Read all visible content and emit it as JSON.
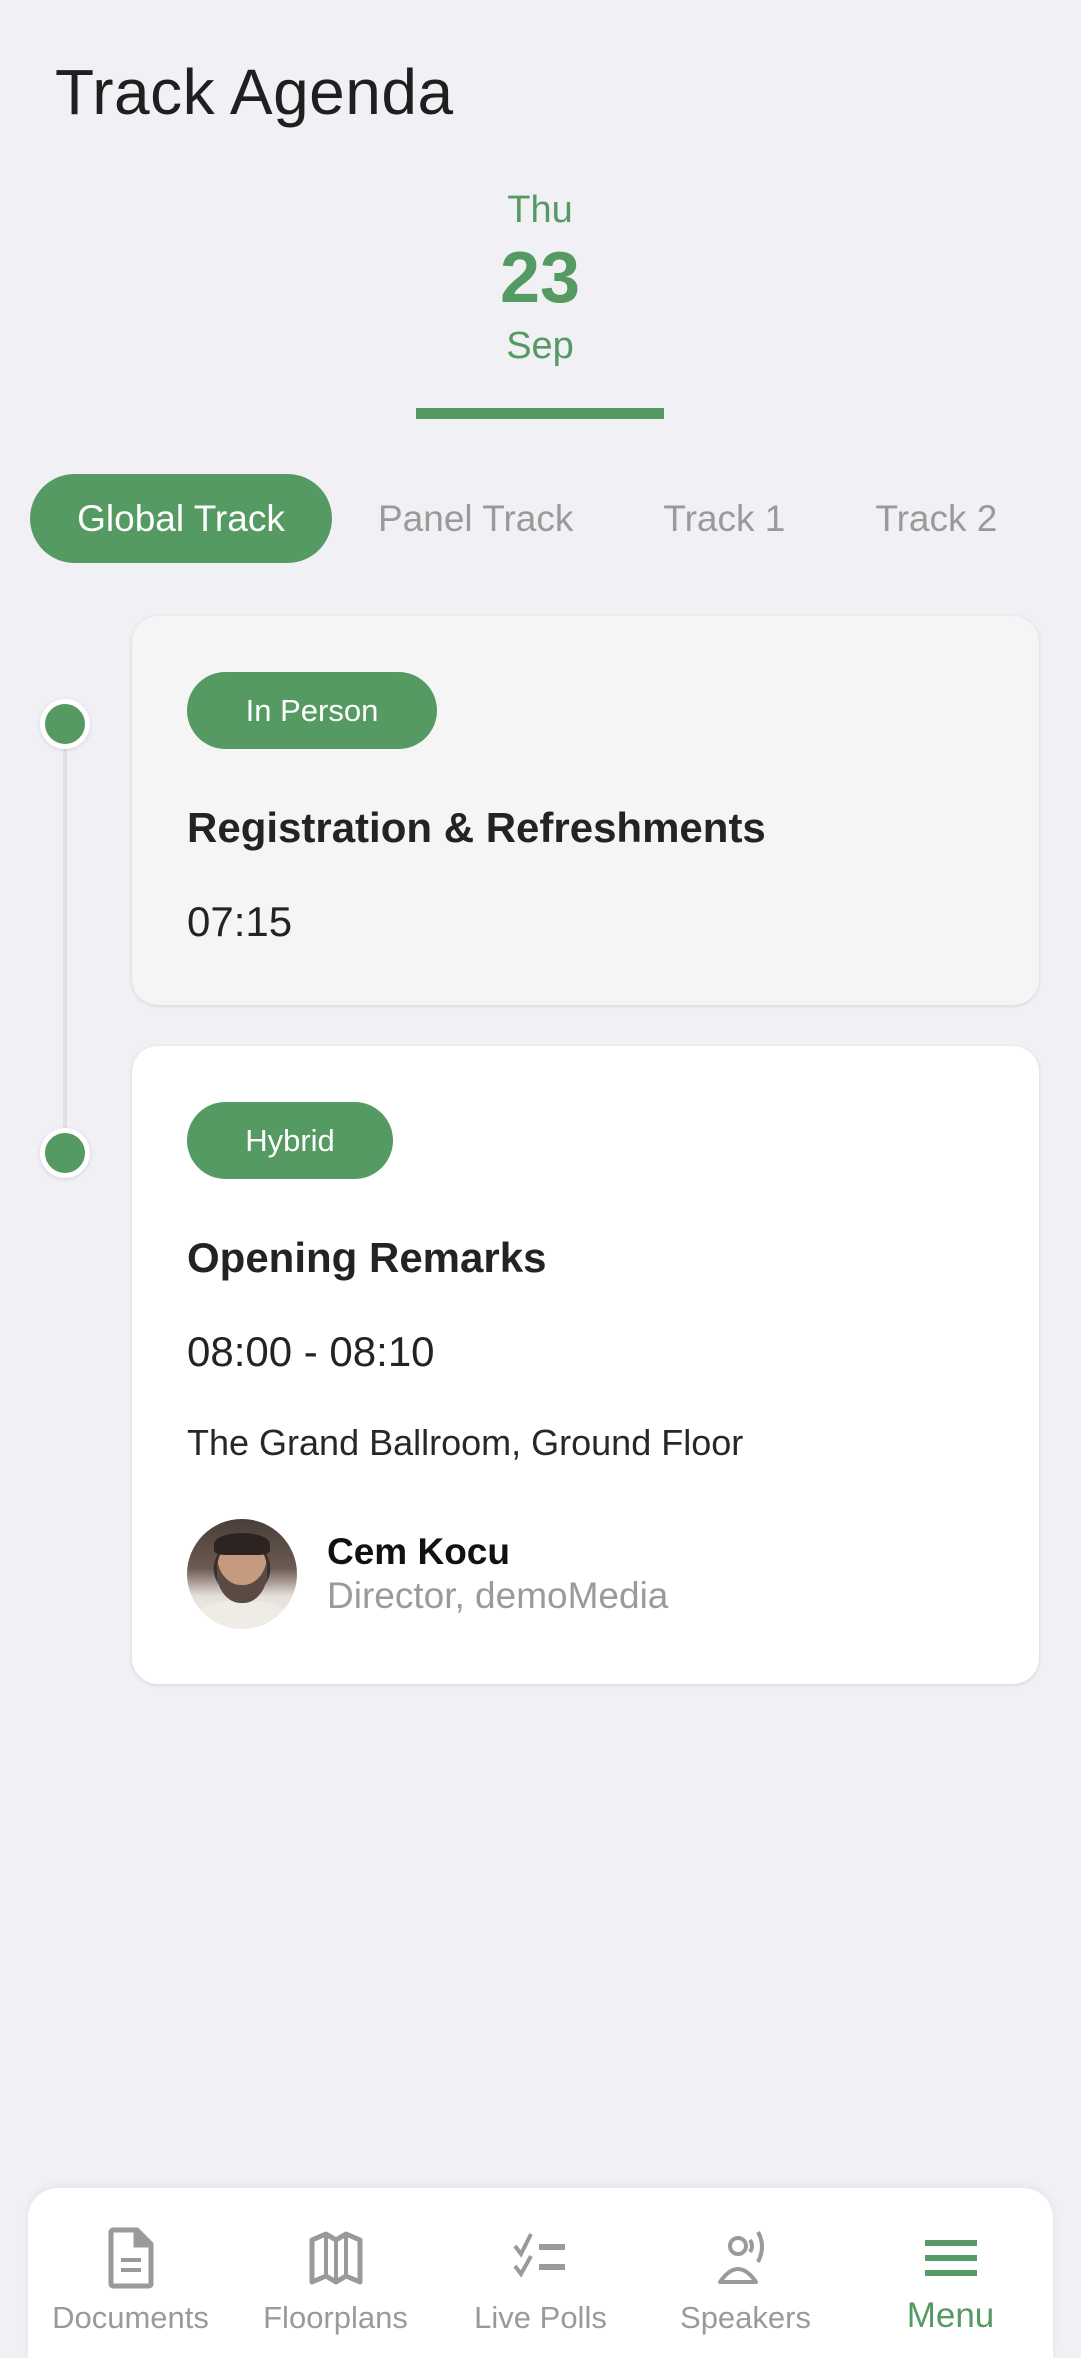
{
  "header": {
    "title": "Track Agenda"
  },
  "date_selector": {
    "selected": {
      "day_of_week": "Thu",
      "day": "23",
      "month": "Sep"
    }
  },
  "tracks": [
    {
      "label": "Global Track",
      "active": true
    },
    {
      "label": "Panel Track",
      "active": false
    },
    {
      "label": "Track 1",
      "active": false
    },
    {
      "label": "Track 2",
      "active": false
    }
  ],
  "sessions": [
    {
      "badge": "In Person",
      "title": "Registration & Refreshments",
      "time": "07:15"
    },
    {
      "badge": "Hybrid",
      "title": "Opening Remarks",
      "time": "08:00 - 08:10",
      "location": "The Grand Ballroom, Ground Floor",
      "speaker": {
        "name": "Cem Kocu",
        "role": "Director, demoMedia"
      }
    }
  ],
  "bottom_nav": [
    {
      "label": "Documents",
      "icon": "document-icon"
    },
    {
      "label": "Floorplans",
      "icon": "map-icon"
    },
    {
      "label": "Live Polls",
      "icon": "checklist-icon"
    },
    {
      "label": "Speakers",
      "icon": "speaker-icon"
    },
    {
      "label": "Menu",
      "icon": "hamburger-menu-icon",
      "active": true
    }
  ],
  "colors": {
    "accent": "#559a62",
    "inactive": "#9a9a9a",
    "background": "#f1f1f5"
  }
}
